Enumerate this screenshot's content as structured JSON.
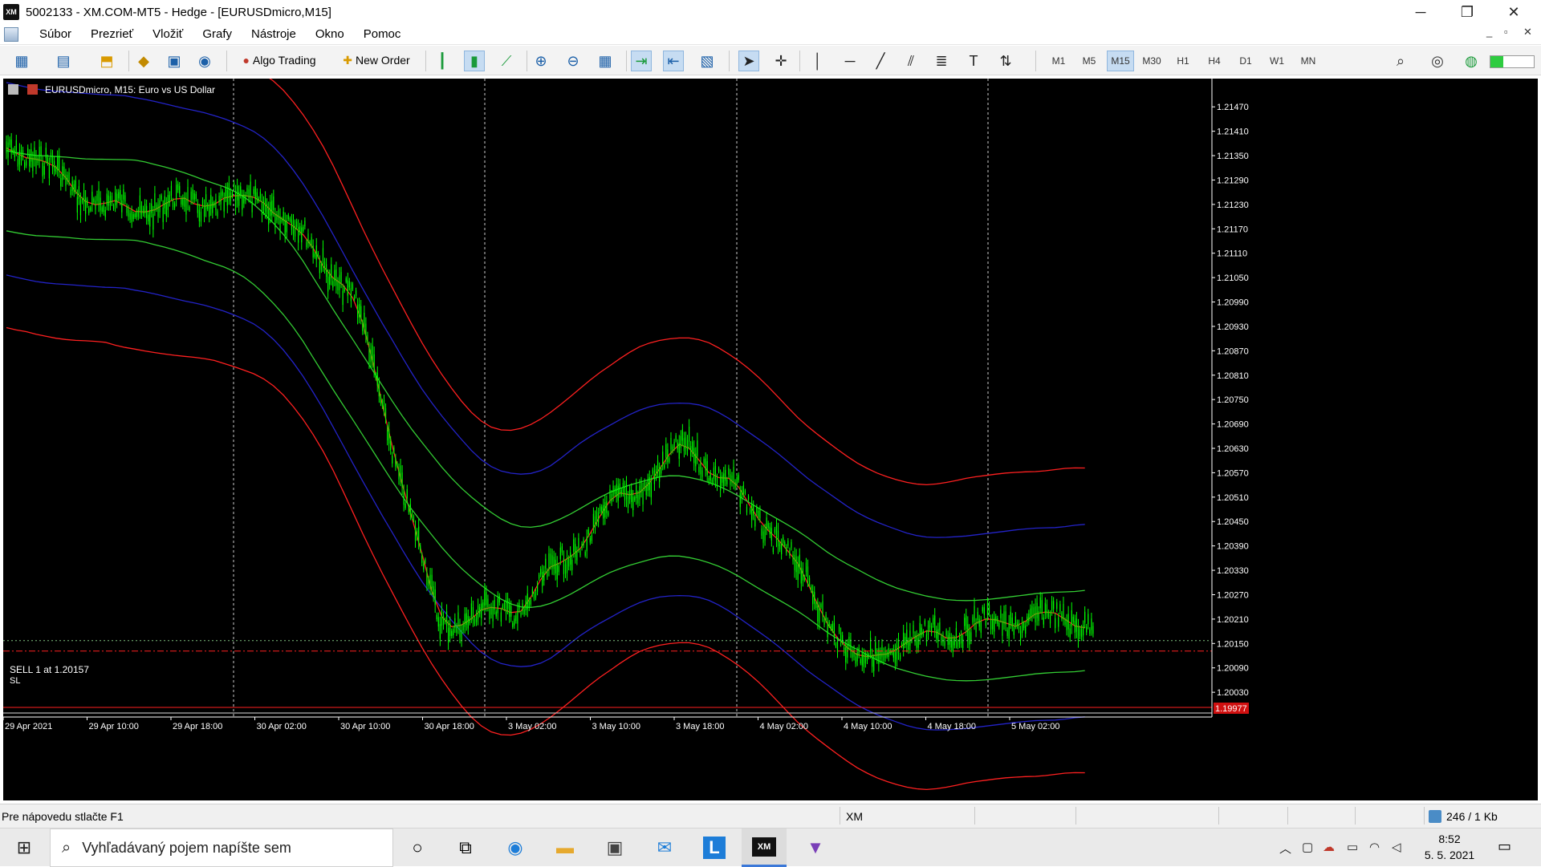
{
  "window": {
    "app_logo": "XM",
    "title": "5002133 - XM.COM-MT5 - Hedge - [EURUSDmicro,M15]",
    "minimize": "─",
    "maximize": "❐",
    "close": "✕"
  },
  "menu": {
    "items": [
      "Súbor",
      "Prezrieť",
      "Vložiť",
      "Grafy",
      "Nástroje",
      "Okno",
      "Pomoc"
    ],
    "mdi_controls": [
      "_",
      "▫",
      "✕"
    ]
  },
  "toolbar": {
    "algo_trading_label": "Algo Trading",
    "new_order_label": "New Order",
    "timeframes": [
      "M1",
      "M5",
      "M15",
      "M30",
      "H1",
      "H4",
      "D1",
      "W1",
      "MN"
    ],
    "active_timeframe": "M15"
  },
  "chart": {
    "header": "EURUSDmicro, M15:  Euro vs US Dollar",
    "price_labels": [
      "1.21470",
      "1.21410",
      "1.21350",
      "1.21290",
      "1.21230",
      "1.21170",
      "1.21110",
      "1.21050",
      "1.20990",
      "1.20930",
      "1.20870",
      "1.20810",
      "1.20750",
      "1.20690",
      "1.20630",
      "1.20570",
      "1.20510",
      "1.20450",
      "1.20390",
      "1.20330",
      "1.20270",
      "1.20210",
      "1.20150",
      "1.20090",
      "1.20030"
    ],
    "time_labels": [
      "29 Apr 2021",
      "29 Apr 10:00",
      "29 Apr 18:00",
      "30 Apr 02:00",
      "30 Apr 10:00",
      "30 Apr 18:00",
      "3 May 02:00",
      "3 May 10:00",
      "3 May 18:00",
      "4 May 02:00",
      "4 May 10:00",
      "4 May 18:00",
      "5 May 02:00"
    ],
    "order_label": "SELL 1 at 1.20157",
    "sl_label": "SL",
    "current_price_label": "1.19977",
    "colors": {
      "background": "#000000",
      "candles": "#00ff00",
      "red_bands": "#ff2020",
      "blue_bands": "#2323c8",
      "green_bands": "#33cc33",
      "order_line": "#7fbf7f",
      "sl_line": "#ff2020"
    }
  },
  "chart_data": {
    "type": "line",
    "symbol": "EURUSDmicro",
    "timeframe": "M15",
    "x": [
      "29 Apr 2021",
      "29 Apr 10:00",
      "29 Apr 18:00",
      "30 Apr 02:00",
      "30 Apr 10:00",
      "30 Apr 18:00",
      "3 May 02:00",
      "3 May 10:00",
      "3 May 18:00",
      "4 May 02:00",
      "4 May 10:00",
      "4 May 18:00",
      "5 May 02:00"
    ],
    "series": [
      {
        "values": [
          1.2137,
          1.2122,
          1.2123,
          1.2124,
          1.21,
          1.202,
          1.2024,
          1.2047,
          1.2064,
          1.2042,
          1.201,
          1.2018,
          1.2021
        ]
      }
    ],
    "ylim": [
      1.19977,
      1.215
    ],
    "order_price": 1.20157,
    "current_price": 1.19977
  },
  "statusbar": {
    "help": "Pre nápovedu stlačte F1",
    "profile": "XM",
    "traffic": "246 / 1 Kb"
  },
  "taskbar": {
    "search_placeholder": "Vyhľadávaný pojem napíšte sem",
    "time": "8:52",
    "date": "5. 5. 2021"
  }
}
